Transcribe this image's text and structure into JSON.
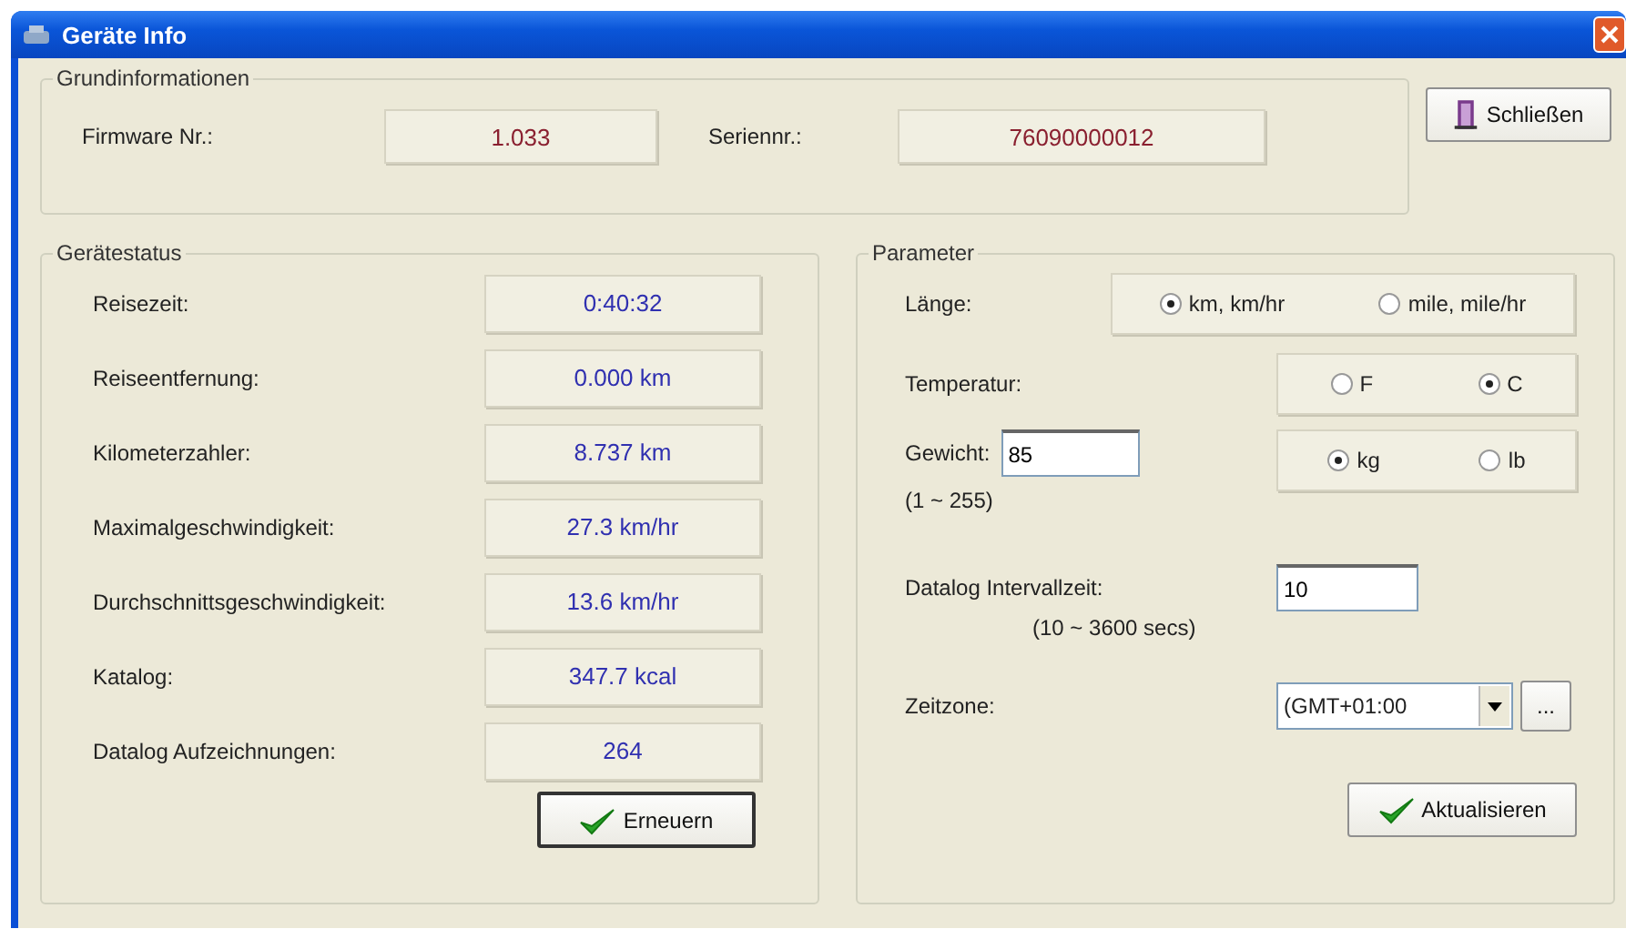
{
  "window": {
    "title": "Geräte Info"
  },
  "basic_info": {
    "legend": "Grundinformationen",
    "fields": [
      {
        "label": "Firmware Nr.:",
        "value": "1.033"
      },
      {
        "label": "Seriennr.:",
        "value": "76090000012"
      }
    ]
  },
  "close_button": {
    "label": "Schließen"
  },
  "device_status": {
    "legend": "Gerätestatus",
    "rows": [
      {
        "label": "Reisezeit:",
        "value": "0:40:32"
      },
      {
        "label": "Reiseentfernung:",
        "value": "0.000 km"
      },
      {
        "label": "Kilometerzahler:",
        "value": "8.737 km"
      },
      {
        "label": "Maximalgeschwindigkeit:",
        "value": "27.3 km/hr"
      },
      {
        "label": "Durchschnittsgeschwindigkeit:",
        "value": "13.6 km/hr"
      },
      {
        "label": "Katalog:",
        "value": "347.7 kcal"
      },
      {
        "label": "Datalog Aufzeichnungen:",
        "value": "264"
      }
    ],
    "button": "Erneuern"
  },
  "parameters": {
    "legend": "Parameter",
    "length": {
      "label": "Länge:",
      "options": [
        {
          "label": "km, km/hr",
          "selected": true
        },
        {
          "label": "mile, mile/hr",
          "selected": false
        }
      ]
    },
    "temperature": {
      "label": "Temperatur:",
      "options": [
        {
          "label": "F",
          "selected": false
        },
        {
          "label": "C",
          "selected": true
        }
      ]
    },
    "weight": {
      "label": "Gewicht:",
      "value": "85",
      "range": "(1 ~ 255)",
      "options": [
        {
          "label": "kg",
          "selected": true
        },
        {
          "label": "lb",
          "selected": false
        }
      ]
    },
    "interval": {
      "label": "Datalog Intervallzeit:",
      "value": "10",
      "range": "(10 ~ 3600 secs)"
    },
    "timezone": {
      "label": "Zeitzone:",
      "value": "(GMT+01:00",
      "more": "..."
    },
    "button": "Aktualisieren"
  }
}
